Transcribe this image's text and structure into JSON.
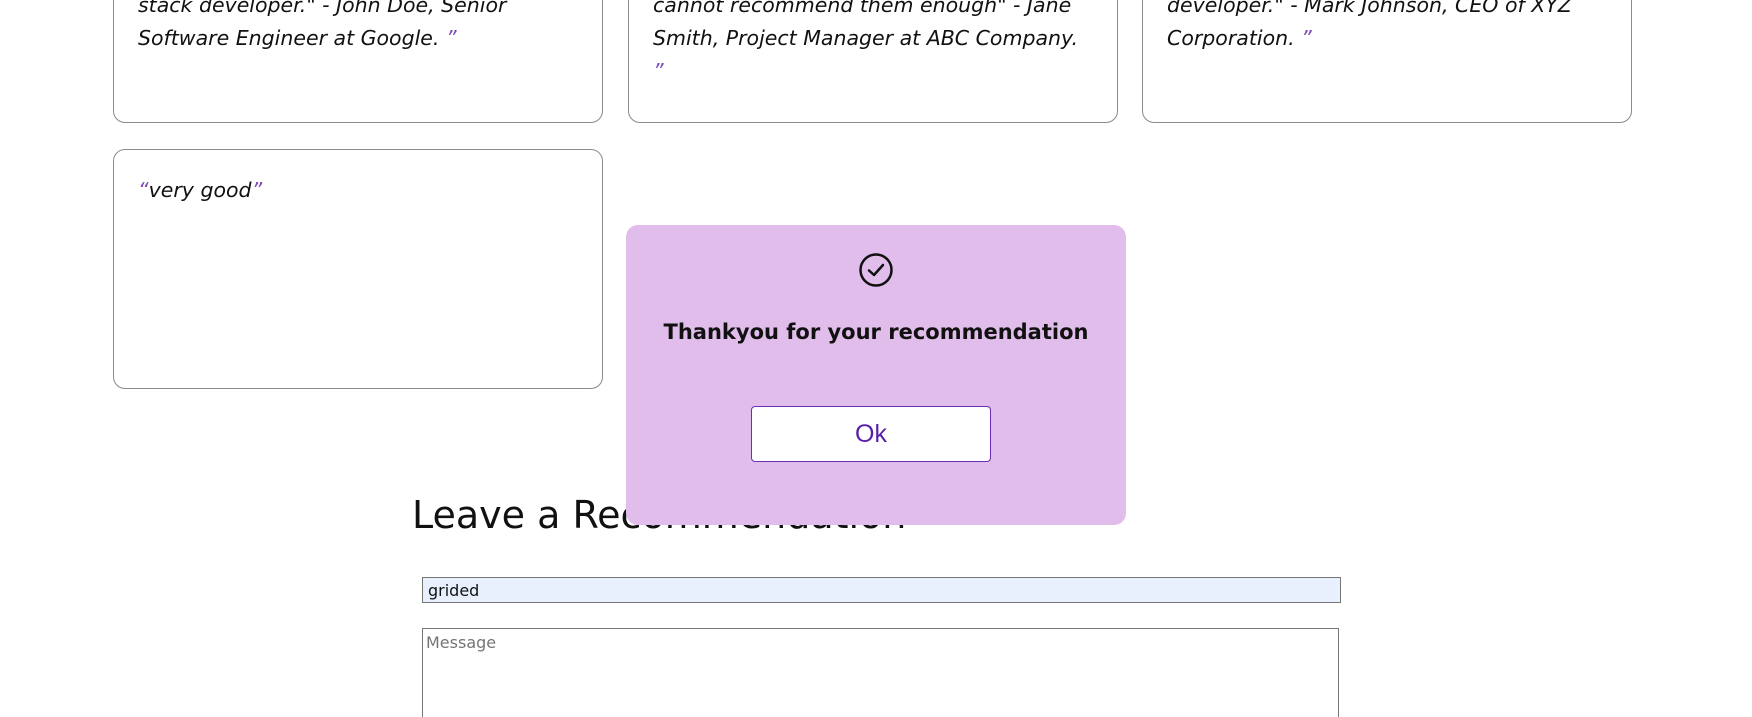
{
  "testimonials": [
    {
      "lines": [
        "stack developer.\"  - John Doe, Senior",
        "Software Engineer at Google."
      ],
      "close_quote": "”"
    },
    {
      "lines": [
        "cannot recommend them enough\" - Jane",
        "Smith, Project Manager at ABC Company."
      ],
      "close_quote": "”"
    },
    {
      "lines": [
        "developer.\" - Mark Johnson, CEO of XYZ",
        "Corporation."
      ],
      "close_quote": "”"
    },
    {
      "open_quote": "“",
      "text": "very good",
      "close_quote": "”"
    }
  ],
  "form": {
    "title": "Leave a Recommendation",
    "name_value": "grided",
    "message_placeholder": "Message"
  },
  "modal": {
    "icon": "check-circle-icon",
    "message": "Thankyou for your recommendation",
    "ok_label": "Ok"
  },
  "colors": {
    "accent": "#5a1fa8",
    "quote": "#7d4bb7",
    "modal_bg": "#e1bdeb",
    "input_autofill_bg": "#e8f0fe"
  }
}
